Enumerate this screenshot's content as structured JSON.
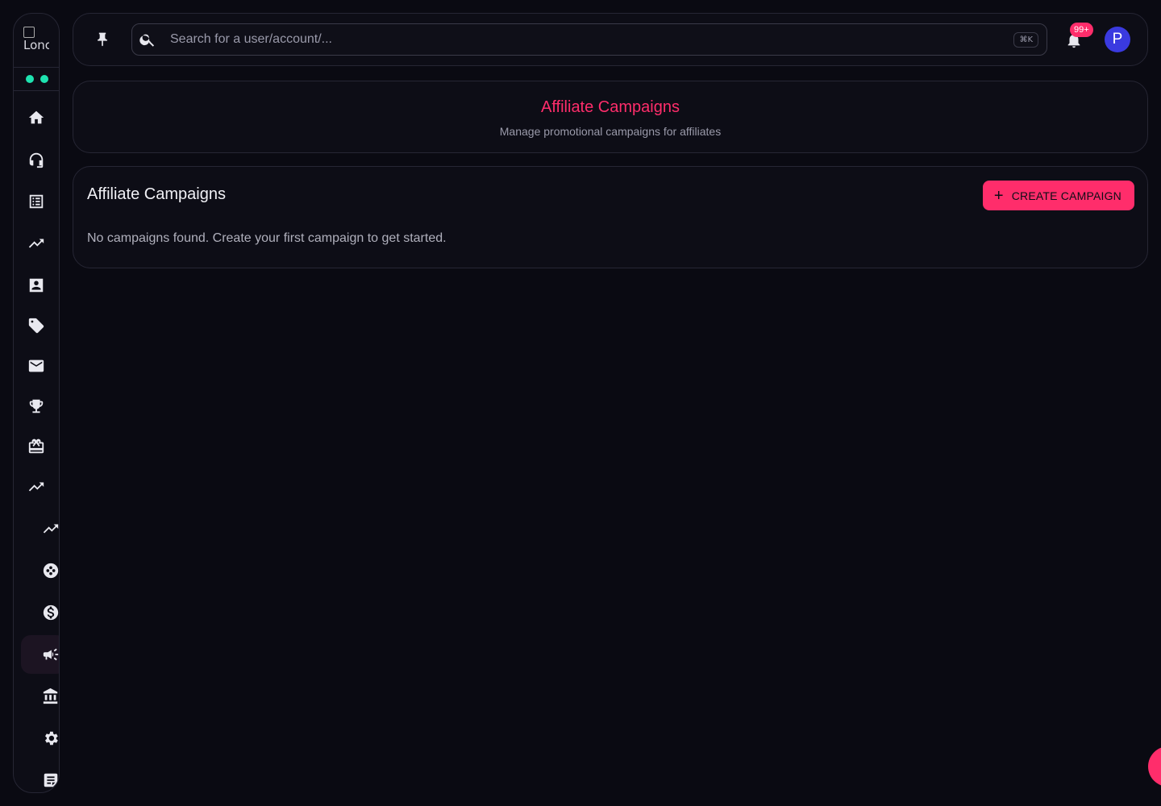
{
  "sidebar": {
    "logo_alt": "Lonc",
    "status_dots": [
      "#1ee3b0",
      "#1ee3b0"
    ],
    "items": [
      {
        "icon": "home-icon"
      },
      {
        "icon": "headset-icon"
      },
      {
        "icon": "list-icon"
      },
      {
        "icon": "trending-up-icon"
      },
      {
        "icon": "contact-card-icon"
      },
      {
        "icon": "tag-icon"
      },
      {
        "icon": "mail-icon"
      },
      {
        "icon": "trophy-icon"
      },
      {
        "icon": "gift-card-icon"
      },
      {
        "icon": "trending-up-icon"
      },
      {
        "icon": "trending-up-icon"
      },
      {
        "icon": "football-icon"
      },
      {
        "icon": "dollar-icon"
      },
      {
        "icon": "megaphone-icon",
        "active": true
      },
      {
        "icon": "bank-icon"
      },
      {
        "icon": "gear-icon"
      },
      {
        "icon": "notes-icon"
      }
    ]
  },
  "topbar": {
    "search_placeholder": "Search for a user/account/...",
    "shortcut": "⌘K",
    "notification_count": "99+",
    "avatar_initial": "P"
  },
  "header": {
    "title": "Affiliate Campaigns",
    "subtitle": "Manage promotional campaigns for affiliates"
  },
  "campaigns": {
    "title": "Affiliate Campaigns",
    "create_label": "CREATE CAMPAIGN",
    "empty_message": "No campaigns found. Create your first campaign to get started."
  },
  "colors": {
    "accent": "#ff2d6b",
    "background": "#0a0a12",
    "status": "#1ee3b0",
    "avatar": "#3a3ae0"
  }
}
